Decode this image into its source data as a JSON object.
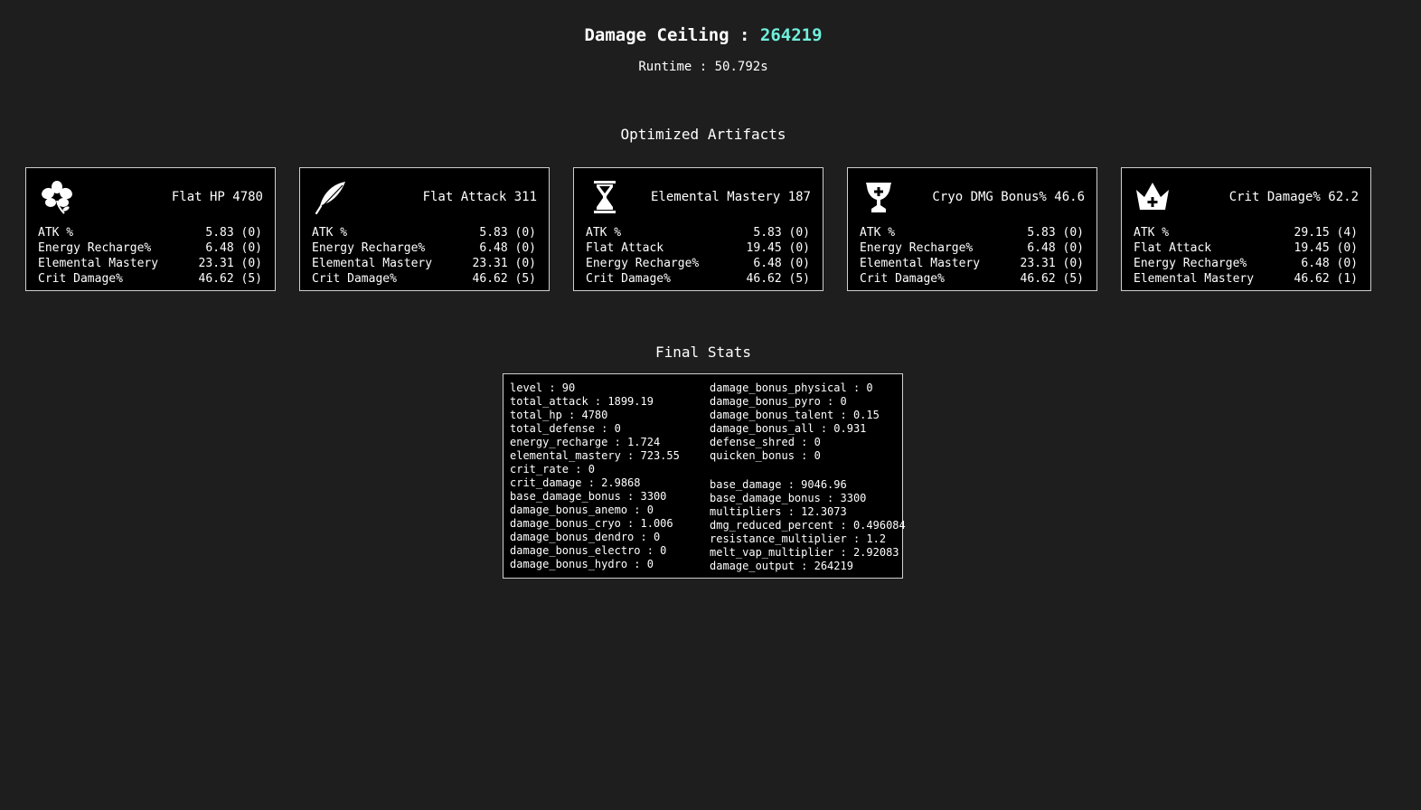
{
  "header": {
    "ceiling_label": "Damage Ceiling :",
    "ceiling_value": "264219",
    "runtime": "Runtime : 50.792s",
    "accent_color": "#6ff0dc"
  },
  "artifacts": {
    "title": "Optimized Artifacts",
    "cards": [
      {
        "icon": "flower-icon",
        "main_stat": "Flat HP 4780",
        "substats": [
          {
            "name": "ATK %",
            "value": "5.83 (0)"
          },
          {
            "name": "Energy Recharge%",
            "value": "6.48 (0)"
          },
          {
            "name": "Elemental Mastery",
            "value": "23.31 (0)"
          },
          {
            "name": "Crit Damage%",
            "value": "46.62 (5)"
          }
        ]
      },
      {
        "icon": "feather-icon",
        "main_stat": "Flat Attack 311",
        "substats": [
          {
            "name": "ATK %",
            "value": "5.83 (0)"
          },
          {
            "name": "Energy Recharge%",
            "value": "6.48 (0)"
          },
          {
            "name": "Elemental Mastery",
            "value": "23.31 (0)"
          },
          {
            "name": "Crit Damage%",
            "value": "46.62 (5)"
          }
        ]
      },
      {
        "icon": "hourglass-icon",
        "main_stat": "Elemental Mastery 187",
        "substats": [
          {
            "name": "ATK %",
            "value": "5.83 (0)"
          },
          {
            "name": "Flat Attack",
            "value": "19.45 (0)"
          },
          {
            "name": "Energy Recharge%",
            "value": "6.48 (0)"
          },
          {
            "name": "Crit Damage%",
            "value": "46.62 (5)"
          }
        ]
      },
      {
        "icon": "goblet-icon",
        "main_stat": "Cryo DMG Bonus% 46.6",
        "substats": [
          {
            "name": "ATK %",
            "value": "5.83 (0)"
          },
          {
            "name": "Energy Recharge%",
            "value": "6.48 (0)"
          },
          {
            "name": "Elemental Mastery",
            "value": "23.31 (0)"
          },
          {
            "name": "Crit Damage%",
            "value": "46.62 (5)"
          }
        ]
      },
      {
        "icon": "crown-icon",
        "main_stat": "Crit Damage% 62.2",
        "substats": [
          {
            "name": "ATK %",
            "value": "29.15 (4)"
          },
          {
            "name": "Flat Attack",
            "value": "19.45 (0)"
          },
          {
            "name": "Energy Recharge%",
            "value": "6.48 (0)"
          },
          {
            "name": "Elemental Mastery",
            "value": "46.62 (1)"
          }
        ]
      }
    ]
  },
  "final_stats": {
    "title": "Final Stats",
    "left": [
      "level : 90",
      "total_attack : 1899.19",
      "total_hp : 4780",
      "total_defense : 0",
      "energy_recharge : 1.724",
      "elemental_mastery : 723.55",
      "crit_rate : 0",
      "crit_damage : 2.9868",
      "base_damage_bonus : 3300",
      "damage_bonus_anemo : 0",
      "damage_bonus_cryo : 1.006",
      "damage_bonus_dendro : 0",
      "damage_bonus_electro : 0",
      "damage_bonus_hydro : 0"
    ],
    "right_top": [
      "damage_bonus_physical : 0",
      "damage_bonus_pyro : 0",
      "damage_bonus_talent : 0.15",
      "damage_bonus_all : 0.931",
      "defense_shred : 0",
      "quicken_bonus : 0"
    ],
    "right_bottom": [
      "base_damage : 9046.96",
      "base_damage_bonus : 3300",
      "multipliers : 12.3073",
      "dmg_reduced_percent : 0.496084",
      "resistance_multiplier : 1.2",
      "melt_vap_multiplier : 2.92083",
      "damage_output : 264219"
    ]
  }
}
